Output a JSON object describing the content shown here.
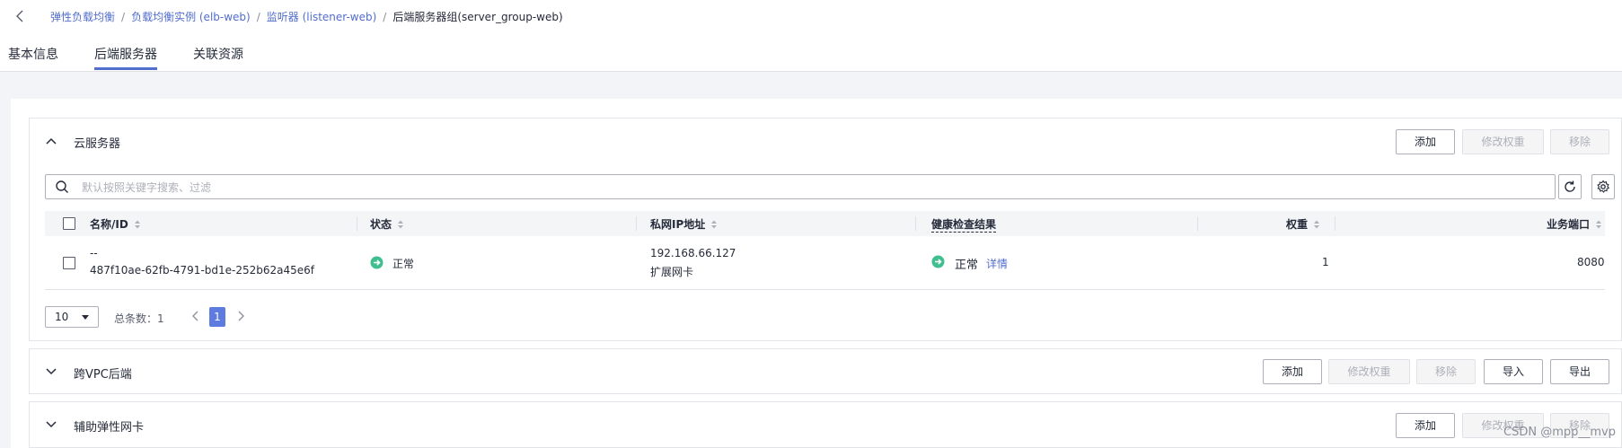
{
  "breadcrumb": {
    "items": [
      "弹性负载均衡",
      "负载均衡实例 (elb-web)",
      "监听器 (listener-web)"
    ],
    "current": "后端服务器组(server_group-web)",
    "separator": "/"
  },
  "tabs": [
    {
      "label": "基本信息",
      "active": false
    },
    {
      "label": "后端服务器",
      "active": true
    },
    {
      "label": "关联资源",
      "active": false
    }
  ],
  "cloud_servers": {
    "title": "云服务器",
    "buttons": {
      "add": "添加",
      "modify_weight": "修改权重",
      "remove": "移除"
    },
    "search": {
      "placeholder": "默认按照关键字搜索、过滤",
      "value": ""
    },
    "columns": {
      "name": "名称/ID",
      "status": "状态",
      "private_ip": "私网IP地址",
      "health": "健康检查结果",
      "weight": "权重",
      "port": "业务端口"
    },
    "rows": [
      {
        "name": "--",
        "id": "487f10ae-62fb-4791-bd1e-252b62a45e6f",
        "status": "正常",
        "ip": "192.168.66.127",
        "ip_type": "扩展网卡",
        "health": "正常",
        "health_link": "详情",
        "weight": "1",
        "port": "8080"
      }
    ],
    "pagination": {
      "page_size": "10",
      "total_label": "总条数：1",
      "current_page": "1"
    }
  },
  "cross_vpc": {
    "title": "跨VPC后端",
    "buttons": {
      "add": "添加",
      "modify_weight": "修改权重",
      "remove": "移除",
      "import": "导入",
      "export": "导出"
    }
  },
  "secondary_nic": {
    "title": "辅助弹性网卡",
    "buttons": {
      "add": "添加",
      "modify_weight": "修改权重",
      "remove": "移除"
    }
  },
  "watermark": "CSDN @mpp__mvp",
  "colors": {
    "accent": "#526ecc",
    "status_ok": "#3fbf8f",
    "page_active": "#5e7ce0"
  }
}
